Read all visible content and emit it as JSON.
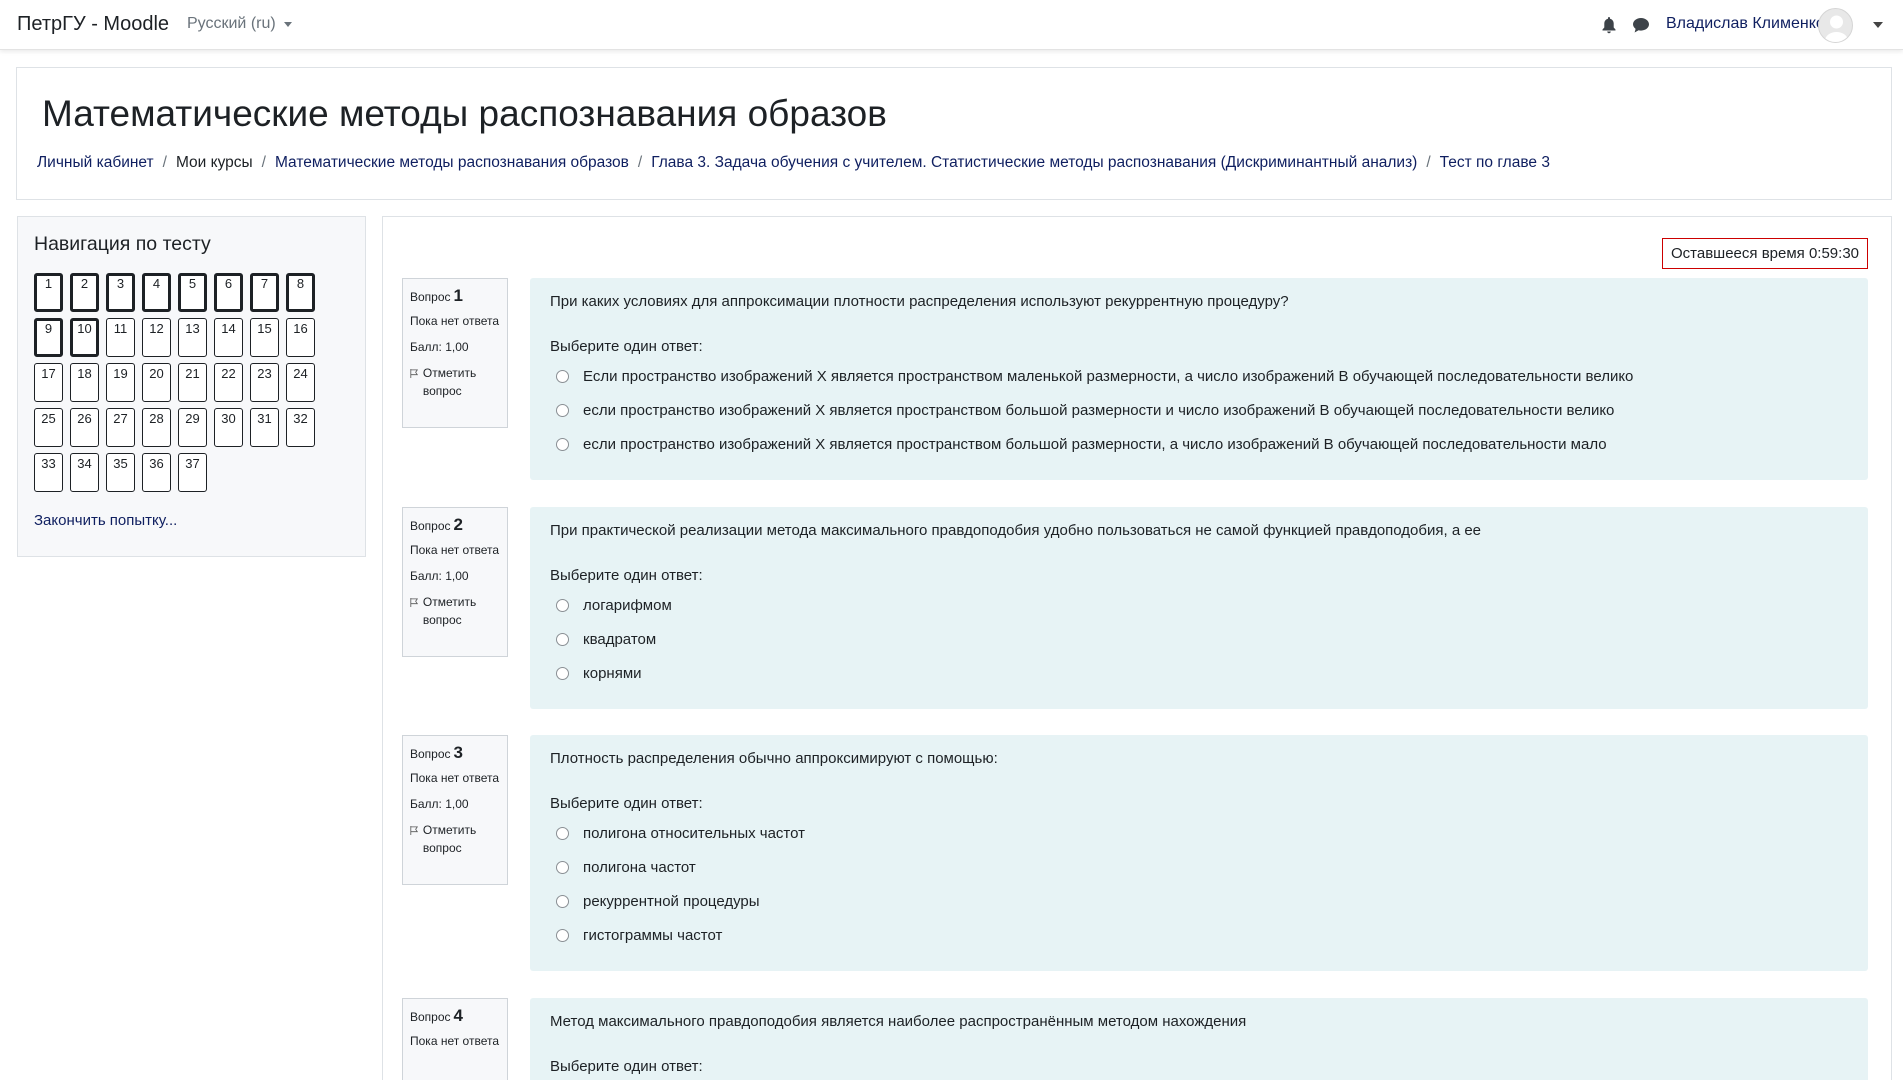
{
  "navbar": {
    "brand": "ПетрГУ - Moodle",
    "language": "Русский (ru)",
    "user_name": "Владислав Клименко",
    "icons": [
      "bell-icon",
      "chat-icon"
    ]
  },
  "header": {
    "title": "Математические методы распознавания образов",
    "breadcrumb": [
      "Личный кабинет",
      "Мои курсы",
      "Математические методы распознавания образов",
      "Глава 3. Задача обучения с учителем. Статистические методы распознавания (Дискриминантный анализ)",
      "Тест по главе 3"
    ]
  },
  "quiz_nav": {
    "title": "Навигация по тесту",
    "buttons": [
      "1",
      "2",
      "3",
      "4",
      "5",
      "6",
      "7",
      "8",
      "9",
      "10",
      "11",
      "12",
      "13",
      "14",
      "15",
      "16",
      "17",
      "18",
      "19",
      "20",
      "21",
      "22",
      "23",
      "24",
      "25",
      "26",
      "27",
      "28",
      "29",
      "30",
      "31",
      "32",
      "33",
      "34",
      "35",
      "36",
      "37"
    ],
    "finish_label": "Закончить попытку..."
  },
  "timer": {
    "label": "Оставшееся время",
    "value": "0:59:30"
  },
  "question_labels": {
    "question": "Вопрос",
    "state": "Пока нет ответа",
    "grade": "Балл: 1,00",
    "flag": "Отметить вопрос",
    "prompt": "Выберите один ответ:"
  },
  "questions": [
    {
      "number": "1",
      "text": "При каких условиях для аппроксимации плотности распределения используют рекуррентную процедуру?",
      "answers": [
        "Если пространство изображений X является пространством маленькой размерности, а число изображений В обучающей последовательности велико",
        "если пространство изображений X является пространством большой размерности и число изображений В обучающей последовательности велико",
        "если пространство изображений X является пространством большой размерности, а число изображений В обучающей последовательности мало"
      ]
    },
    {
      "number": "2",
      "text": "При практической реализации метода максимального правдоподобия удобно пользоваться не самой функцией правдоподобия, а ее",
      "answers": [
        "логарифмом",
        "квадратом",
        "корнями"
      ]
    },
    {
      "number": "3",
      "text": "Плотность распределения обычно аппроксимируют с помощью:",
      "answers": [
        "полигона относительных частот",
        "полигона частот",
        "рекуррентной процедуры",
        "гистограммы частот"
      ]
    },
    {
      "number": "4",
      "text": "Метод максимального правдоподобия является наиболее распространённым методом нахождения",
      "answers": []
    }
  ]
}
